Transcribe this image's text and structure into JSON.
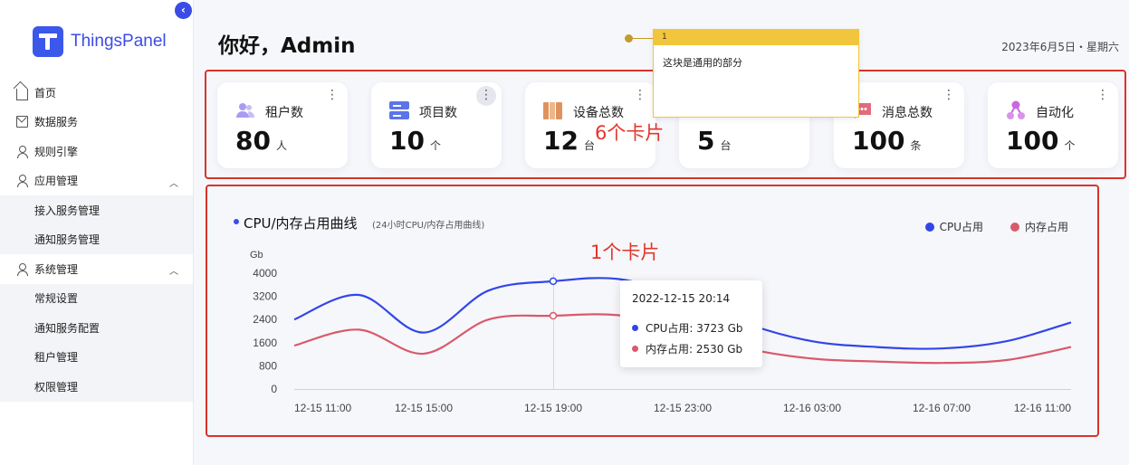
{
  "sidebar": {
    "logo_text": "ThingsPanel",
    "collapse_icon": "chevron-left-icon",
    "items": [
      {
        "label": "首页",
        "icon": "home-icon"
      },
      {
        "label": "数据服务",
        "icon": "mail-icon"
      },
      {
        "label": "规则引擎",
        "icon": "user-icon"
      },
      {
        "label": "应用管理",
        "icon": "user-icon",
        "expanded": true,
        "children": [
          {
            "label": "接入服务管理"
          },
          {
            "label": "通知服务管理"
          }
        ]
      },
      {
        "label": "系统管理",
        "icon": "user-icon",
        "expanded": true,
        "children": [
          {
            "label": "常规设置"
          },
          {
            "label": "通知服务配置"
          },
          {
            "label": "租户管理"
          },
          {
            "label": "权限管理"
          }
        ]
      }
    ]
  },
  "header": {
    "greeting": "你好，Admin",
    "date": "2023年6月5日・星期六"
  },
  "note": {
    "number": "1",
    "text": "这块是通用的部分"
  },
  "annotations": {
    "cards": "6个卡片",
    "chart": "1个卡片"
  },
  "cards": [
    {
      "title": "租户数",
      "value": "80",
      "unit": "人",
      "icon": "users-icon",
      "color": "#a99bf2"
    },
    {
      "title": "项目数",
      "value": "10",
      "unit": "个",
      "icon": "server-icon",
      "color": "#5b74e8"
    },
    {
      "title": "设备总数",
      "value": "12",
      "unit": "台",
      "icon": "books-icon",
      "color": "#e0925e"
    },
    {
      "title": "",
      "value": "5",
      "unit": "台",
      "icon": "device-icon",
      "color": "#7a8aa8"
    },
    {
      "title": "消息总数",
      "value": "100",
      "unit": "条",
      "icon": "message-icon",
      "color": "#e36b7a"
    },
    {
      "title": "自动化",
      "value": "100",
      "unit": "个",
      "icon": "automation-icon",
      "color": "#c86adf"
    }
  ],
  "chart": {
    "title": "CPU/内存占用曲线",
    "subtitle": "(24小时CPU/内存占用曲线)",
    "legend": [
      {
        "name": "CPU占用",
        "color": "#3246e8"
      },
      {
        "name": "内存占用",
        "color": "#d95a6b"
      }
    ],
    "tooltip": {
      "time": "2022-12-15  20:14",
      "rows": [
        {
          "label": "CPU占用:  3723 Gb",
          "color": "#3246e8"
        },
        {
          "label": "内存占用:  2530 Gb",
          "color": "#d95a6b"
        }
      ]
    }
  },
  "chart_data": {
    "type": "line",
    "ylabel": "Gb",
    "ylim": [
      0,
      4000
    ],
    "yticks": [
      "4000",
      "3200",
      "2400",
      "1600",
      "800",
      "0"
    ],
    "x_ticks": [
      "12-15  11:00",
      "12-15  15:00",
      "12-15  19:00",
      "12-15  23:00",
      "12-16  03:00",
      "12-16  07:00",
      "12-16  11:00"
    ],
    "x": [
      "12-15 11:00",
      "12-15 13:00",
      "12-15 15:00",
      "12-15 17:00",
      "12-15 19:00",
      "12-15 21:00",
      "12-15 23:00",
      "12-16 01:00",
      "12-16 03:00",
      "12-16 05:00",
      "12-16 07:00",
      "12-16 09:00",
      "12-16 11:00"
    ],
    "series": [
      {
        "name": "CPU占用",
        "color": "#3246e8",
        "values": [
          2400,
          3250,
          1950,
          3400,
          3723,
          3800,
          3200,
          2250,
          1650,
          1450,
          1400,
          1650,
          2300
        ]
      },
      {
        "name": "内存占用",
        "color": "#d95a6b",
        "values": [
          1500,
          2050,
          1220,
          2400,
          2530,
          2550,
          2100,
          1400,
          1050,
          950,
          900,
          1000,
          1450
        ]
      }
    ]
  }
}
